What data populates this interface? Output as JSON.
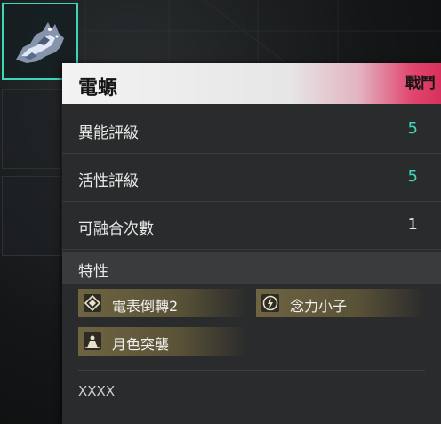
{
  "item": {
    "name": "電螈",
    "category_tag": "戰鬥",
    "icon": "crystal-creature-icon"
  },
  "stats": [
    {
      "label": "異能評級",
      "value": "5",
      "color": "#3fd6b8"
    },
    {
      "label": "活性評級",
      "value": "5",
      "color": "#3fd6b8"
    },
    {
      "label": "可融合次數",
      "value": "1",
      "color": "#e8e8e8"
    }
  ],
  "traits": {
    "title": "特性",
    "items": [
      {
        "label": "電表倒轉2",
        "icon": "diamond-icon"
      },
      {
        "label": "念力小子",
        "icon": "lightning-circle-icon"
      },
      {
        "label": "月色突襲",
        "icon": "figure-icon"
      }
    ]
  },
  "description": "XXXX",
  "colors": {
    "accent": "#3fd6b8",
    "tag": "#d8305c",
    "trait_bg": "#6e6442"
  }
}
